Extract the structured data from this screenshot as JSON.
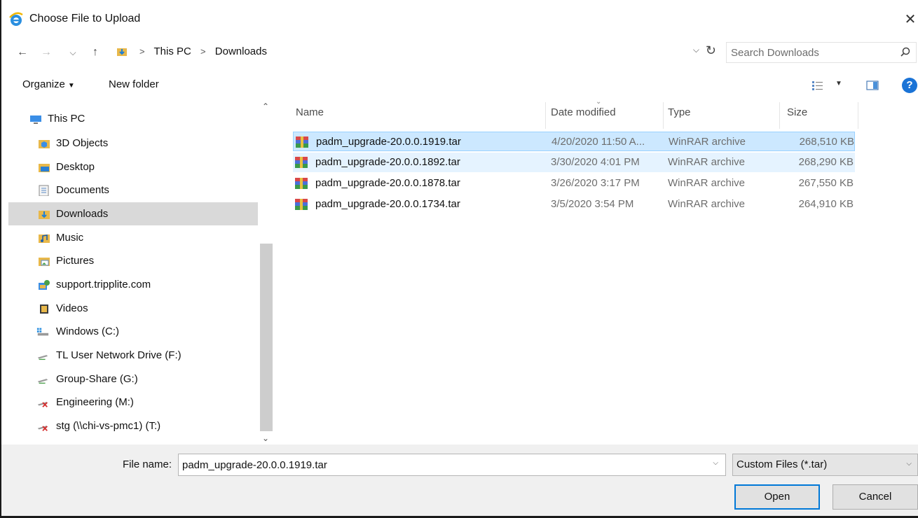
{
  "window": {
    "title": "Choose File to Upload",
    "close_glyph": "✕"
  },
  "nav": {
    "back_glyph": "←",
    "forward_glyph": "→",
    "recent_glyph": "⌵",
    "up_glyph": "↑",
    "breadcrumbs": [
      "This PC",
      "Downloads"
    ],
    "separator": ">",
    "addr_dropdown_glyph": "⌵",
    "refresh_glyph": "↻",
    "search_placeholder": "Search Downloads"
  },
  "commands": {
    "organize_label": "Organize",
    "caret": "▼",
    "new_folder_label": "New folder",
    "help_label": "?"
  },
  "sidebar": {
    "scroll_up": "⌃",
    "scroll_down": "⌄",
    "items": [
      {
        "label": "This PC",
        "icon": "computer-icon",
        "selected": false
      },
      {
        "label": "3D Objects",
        "icon": "3d-objects-icon",
        "selected": false
      },
      {
        "label": "Desktop",
        "icon": "desktop-icon",
        "selected": false
      },
      {
        "label": "Documents",
        "icon": "documents-icon",
        "selected": false
      },
      {
        "label": "Downloads",
        "icon": "downloads-icon",
        "selected": true
      },
      {
        "label": "Music",
        "icon": "music-icon",
        "selected": false
      },
      {
        "label": "Pictures",
        "icon": "pictures-icon",
        "selected": false
      },
      {
        "label": "support.tripplite.com",
        "icon": "web-location-icon",
        "selected": false
      },
      {
        "label": "Videos",
        "icon": "videos-icon",
        "selected": false
      },
      {
        "label": "Windows (C:)",
        "icon": "windows-drive-icon",
        "selected": false
      },
      {
        "label": "TL User Network Drive (F:)",
        "icon": "network-drive-icon",
        "selected": false
      },
      {
        "label": "Group-Share (G:)",
        "icon": "network-drive-icon",
        "selected": false
      },
      {
        "label": "Engineering (M:)",
        "icon": "disconnected-drive-icon",
        "selected": false
      },
      {
        "label": "stg (\\\\chi-vs-pmc1) (T:)",
        "icon": "disconnected-drive-icon",
        "selected": false
      }
    ]
  },
  "files": {
    "sort_caret": "⌄",
    "columns": {
      "name": "Name",
      "date": "Date modified",
      "type": "Type",
      "size": "Size"
    },
    "rows": [
      {
        "name": "padm_upgrade-20.0.0.1919.tar",
        "date": "4/20/2020 11:50 A...",
        "type": "WinRAR archive",
        "size": "268,510 KB",
        "state": "selected"
      },
      {
        "name": "padm_upgrade-20.0.0.1892.tar",
        "date": "3/30/2020 4:01 PM",
        "type": "WinRAR archive",
        "size": "268,290 KB",
        "state": "secondary"
      },
      {
        "name": "padm_upgrade-20.0.0.1878.tar",
        "date": "3/26/2020 3:17 PM",
        "type": "WinRAR archive",
        "size": "267,550 KB",
        "state": "none"
      },
      {
        "name": "padm_upgrade-20.0.0.1734.tar",
        "date": "3/5/2020 3:54 PM",
        "type": "WinRAR archive",
        "size": "264,910 KB",
        "state": "none"
      }
    ]
  },
  "footer": {
    "file_name_label": "File name:",
    "file_name_value": "padm_upgrade-20.0.0.1919.tar",
    "dropdown_glyph": "⌵",
    "filter_label": "Custom Files (*.tar)",
    "open_label": "Open",
    "cancel_label": "Cancel"
  },
  "colors": {
    "selection": "#cce8ff",
    "selection_border": "#99d1ff",
    "accent": "#0078d7",
    "help": "#1a73d6"
  }
}
